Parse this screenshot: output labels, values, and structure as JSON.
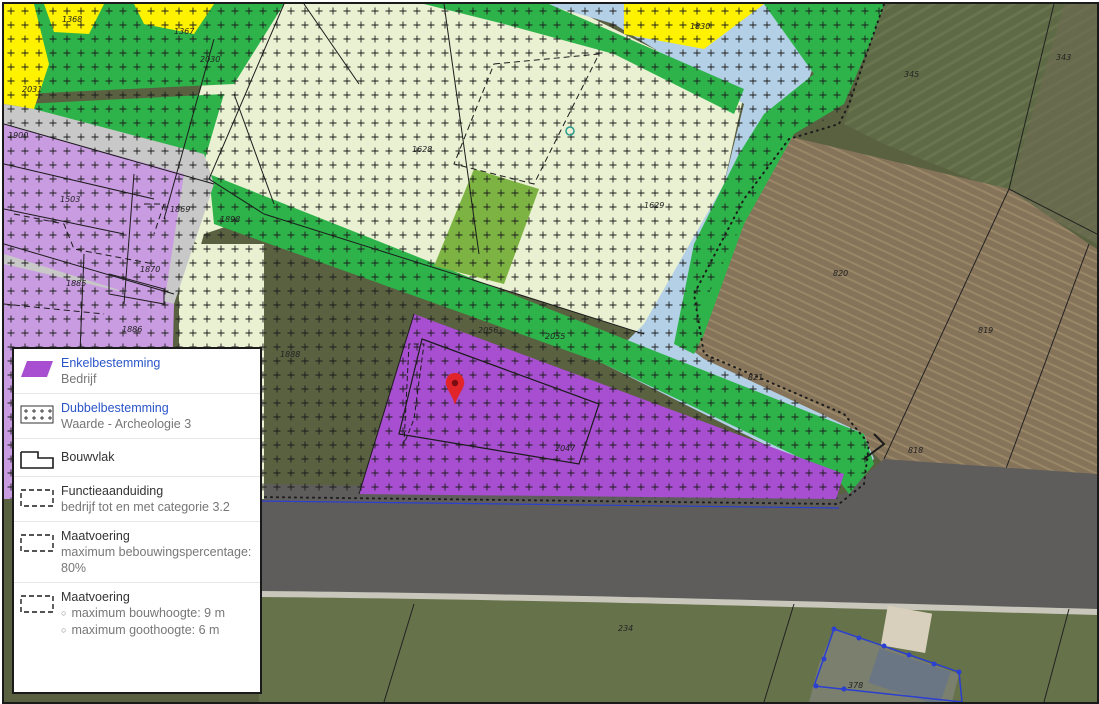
{
  "map": {
    "parcels": [
      {
        "id": "p1368",
        "label": "1368"
      },
      {
        "id": "p1367",
        "label": "1367"
      },
      {
        "id": "p2030",
        "label": "2030"
      },
      {
        "id": "p2031",
        "label": "2031"
      },
      {
        "id": "p1900",
        "label": "1900"
      },
      {
        "id": "p1503",
        "label": "1503"
      },
      {
        "id": "p1869",
        "label": "1869"
      },
      {
        "id": "p1898",
        "label": "1898"
      },
      {
        "id": "p1870",
        "label": "1870"
      },
      {
        "id": "p1885",
        "label": "1885"
      },
      {
        "id": "p1886",
        "label": "1886"
      },
      {
        "id": "p1888",
        "label": "1888"
      },
      {
        "id": "p1628",
        "label": "1628"
      },
      {
        "id": "p1629",
        "label": "1629"
      },
      {
        "id": "p1830",
        "label": "1830"
      },
      {
        "id": "p345",
        "label": "345"
      },
      {
        "id": "p343",
        "label": "343"
      },
      {
        "id": "p820",
        "label": "820"
      },
      {
        "id": "p819",
        "label": "819"
      },
      {
        "id": "p2056",
        "label": "2056"
      },
      {
        "id": "p2055",
        "label": "2055"
      },
      {
        "id": "p821",
        "label": "821"
      },
      {
        "id": "p2047",
        "label": "2047"
      },
      {
        "id": "p818",
        "label": "818"
      },
      {
        "id": "p234",
        "label": "234"
      },
      {
        "id": "p378",
        "label": "378"
      }
    ],
    "marker": {
      "icon": "map-pin-icon",
      "color": "#e0242a"
    }
  },
  "legend": {
    "items": [
      {
        "title": "Enkelbestemming",
        "subtitle": "Bedrijf",
        "swatch": "purple-fill",
        "title_color": "#2a55c8"
      },
      {
        "title": "Dubbelbestemming",
        "subtitle": "Waarde - Archeologie 3",
        "swatch": "cross-hatch",
        "title_color": "#2a55c8"
      },
      {
        "title": "Bouwvlak",
        "swatch": "solid-outline"
      },
      {
        "title": "Functieaanduiding",
        "subtitle": "bedrijf tot en met categorie 3.2",
        "swatch": "dashed-outline"
      },
      {
        "title": "Maatvoering",
        "subtitle": "maximum bebouwingspercentage: 80%",
        "swatch": "dashed-outline"
      },
      {
        "title": "Maatvoering",
        "bullets": [
          "maximum bouwhoogte: 9 m",
          "maximum goothoogte: 6 m"
        ],
        "swatch": "dashed-outline"
      }
    ]
  },
  "colors": {
    "bedrijf": "#a74fd0",
    "wonen_purple": "#c99be0",
    "groen": "#2db34a",
    "agrarisch": "#eaf0d2",
    "water": "#b3d0e6",
    "yellow": "#fff200",
    "grey": "#c8c8c8",
    "olive": "#7cb342",
    "link": "#2a55c8"
  }
}
